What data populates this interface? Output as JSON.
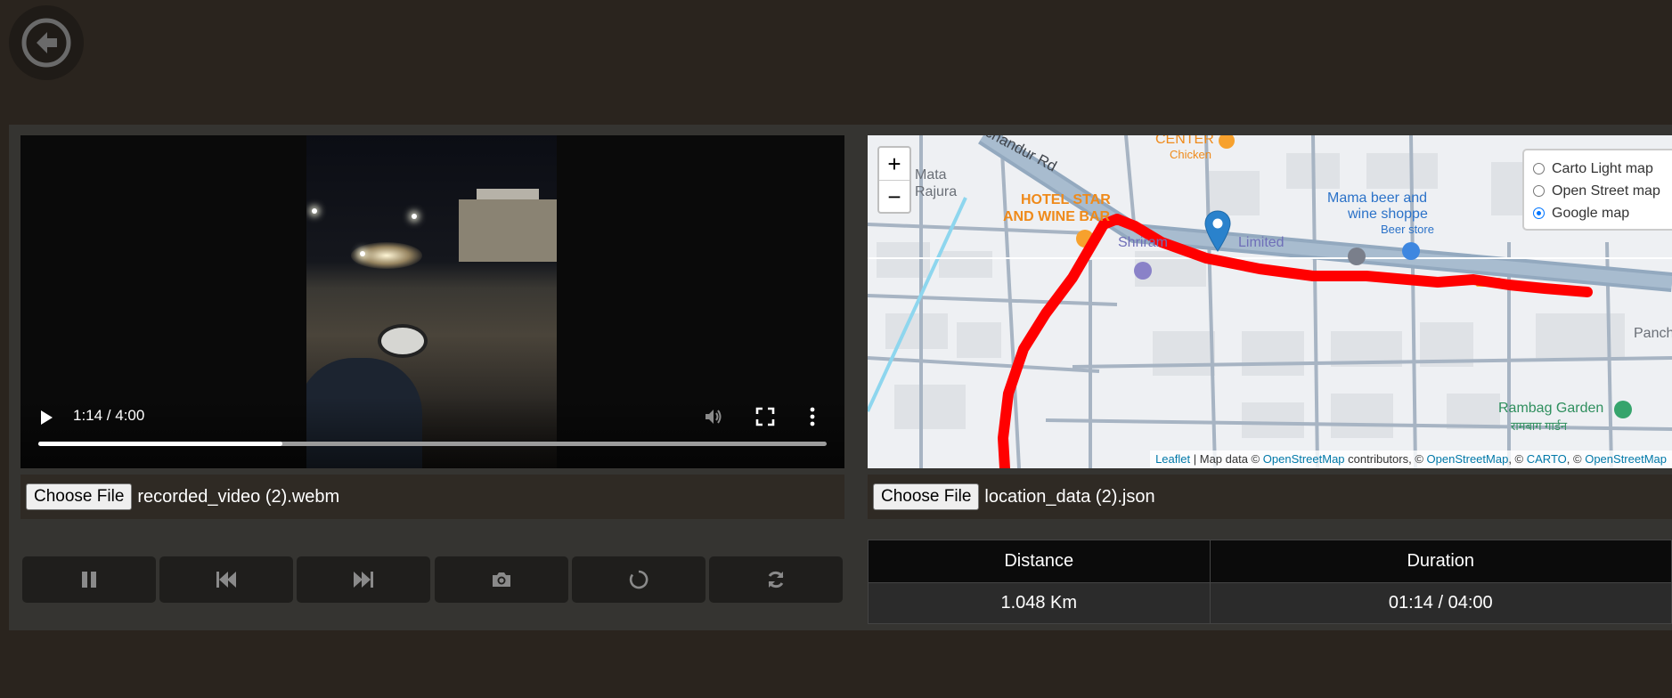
{
  "video": {
    "current_time": "1:14",
    "duration": "4:00",
    "time_display": "1:14 / 4:00",
    "progress_fraction": 0.31
  },
  "video_file": {
    "button_label": "Choose File",
    "file_name": "recorded_video (2).webm"
  },
  "map_file": {
    "button_label": "Choose File",
    "file_name": "location_data (2).json"
  },
  "controls": [
    {
      "name": "pause-button",
      "icon": "pause-icon"
    },
    {
      "name": "previous-button",
      "icon": "skip-back-icon"
    },
    {
      "name": "next-button",
      "icon": "skip-forward-icon"
    },
    {
      "name": "snapshot-button",
      "icon": "camera-icon"
    },
    {
      "name": "loading-button",
      "icon": "spinner-icon"
    },
    {
      "name": "refresh-button",
      "icon": "refresh-icon"
    }
  ],
  "map": {
    "zoom_in": "+",
    "zoom_out": "−",
    "layers": [
      {
        "label": "Carto Light map",
        "selected": false
      },
      {
        "label": "Open Street map",
        "selected": false
      },
      {
        "label": "Google map",
        "selected": true
      }
    ],
    "labels": {
      "road": "chandur Rd",
      "center": "CENTER",
      "chicken": "Chicken",
      "mata": "Mata",
      "rajura": "Rajura",
      "hotel_1": "HOTEL STAR",
      "hotel_2": "AND WINE BAR",
      "shriram": "Shriram",
      "limited": "Limited",
      "beer_1": "Mama beer and",
      "beer_2": "wine shoppe",
      "beer_store": "Beer store",
      "panch": "Panch",
      "rambag_1": "Rambag Garden",
      "rambag_2": "रामबाग गार्डन"
    },
    "attribution": {
      "leaflet": "Leaflet",
      "map_data": "Map data ©",
      "osm": "OpenStreetMap",
      "contributors": "contributors, ©",
      "osm2": "OpenStreetMap",
      "sep1": ", ©",
      "carto": "CARTO",
      "sep2": ", ©",
      "osm3": "OpenStreetMap"
    },
    "route_color": "#ff0000"
  },
  "stats": {
    "headers": [
      "Distance",
      "Duration"
    ],
    "values": [
      "1.048 Km",
      "01:14 / 04:00"
    ]
  },
  "colors": {
    "background": "#2a241e",
    "panel": "#353431",
    "accent": "#0075ff"
  }
}
